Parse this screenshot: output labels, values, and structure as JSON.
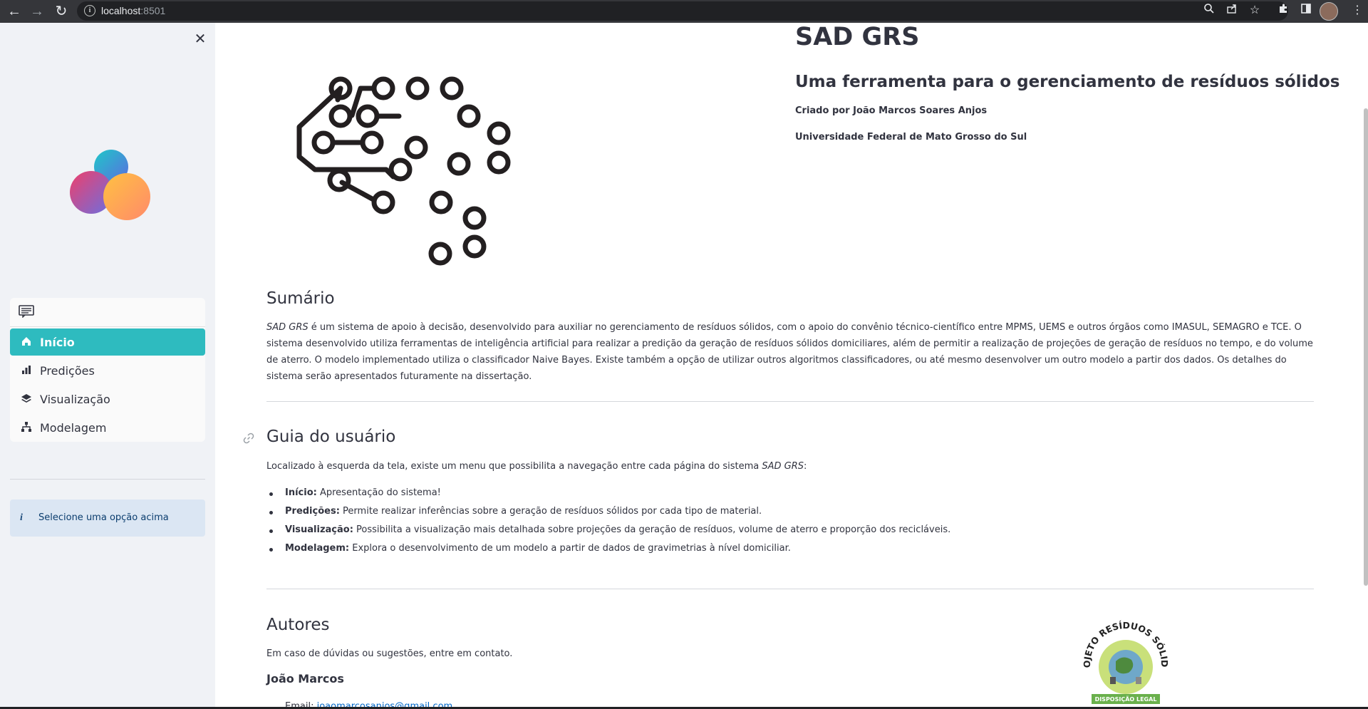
{
  "browser": {
    "url_host": "localhost",
    "url_port": ":8501"
  },
  "sidebar": {
    "menu": {
      "items": [
        {
          "label": "Início",
          "icon": "house-icon",
          "active": true
        },
        {
          "label": "Predições",
          "icon": "bar-chart-icon",
          "active": false
        },
        {
          "label": "Visualização",
          "icon": "layers-icon",
          "active": false
        },
        {
          "label": "Modelagem",
          "icon": "diagram-icon",
          "active": false
        }
      ]
    },
    "info_text": "Selecione uma opção acima"
  },
  "main": {
    "title": "SAD GRS",
    "subtitle": "Uma ferramenta para o gerenciamento de resíduos sólidos",
    "created_by": "Criado por João Marcos Soares Anjos",
    "university": "Universidade Federal de Mato Grosso do Sul",
    "summary": {
      "heading": "Sumário",
      "text_em": "SAD GRS",
      "text": " é um sistema de apoio à decisão, desenvolvido para auxiliar no gerenciamento de resíduos sólidos, com o apoio do convênio técnico-científico entre MPMS, UEMS e outros órgãos como IMASUL, SEMAGRO e TCE. O sistema desenvolvido utiliza ferramentas de inteligência artificial para realizar a predição da geração de resíduos sólidos domiciliares, além de permitir a realização de projeções de geração de resíduos no tempo, e do volume de aterro. O modelo implementado utiliza o classificador Naive Bayes. Existe também a opção de utilizar outros algoritmos classificadores, ou até mesmo desenvolver um outro modelo a partir dos dados. Os detalhes do sistema serão apresentados futuramente na dissertação."
    },
    "guide": {
      "heading": "Guia do usuário",
      "intro": "Localizado à esquerda da tela, existe um menu que possibilita a navegação entre cada página do sistema ",
      "intro_em": "SAD GRS",
      "intro_end": ":",
      "items": [
        {
          "bold": "Início:",
          "text": " Apresentação do sistema!"
        },
        {
          "bold": "Predições:",
          "text": " Permite realizar inferências sobre a geração de resíduos sólidos por cada tipo de material."
        },
        {
          "bold": "Visualização:",
          "text": " Possibilita a visualização mais detalhada sobre projeções da geração de resíduos, volume de aterro e proporção dos recicláveis."
        },
        {
          "bold": "Modelagem:",
          "text": " Explora o desenvolvimento de um modelo a partir de dados de gravimetrias à nível domiciliar."
        }
      ]
    },
    "authors": {
      "heading": "Autores",
      "text": "Em caso de dúvidas ou sugestões, entre em contato.",
      "name": "João Marcos",
      "email_label": "Email: ",
      "email": "joaomarcosanjos@gmail.com"
    },
    "badge": {
      "arc_text": "PROJETO RESÍDUOS SÓLIDOS",
      "ribbon_text": "DISPOSIÇÃO LEGAL"
    }
  },
  "colors": {
    "accent": "#2ebbbf",
    "sidebar_bg": "#f0f2f6",
    "info_bg": "#dbe6f3",
    "text": "#31333f"
  }
}
